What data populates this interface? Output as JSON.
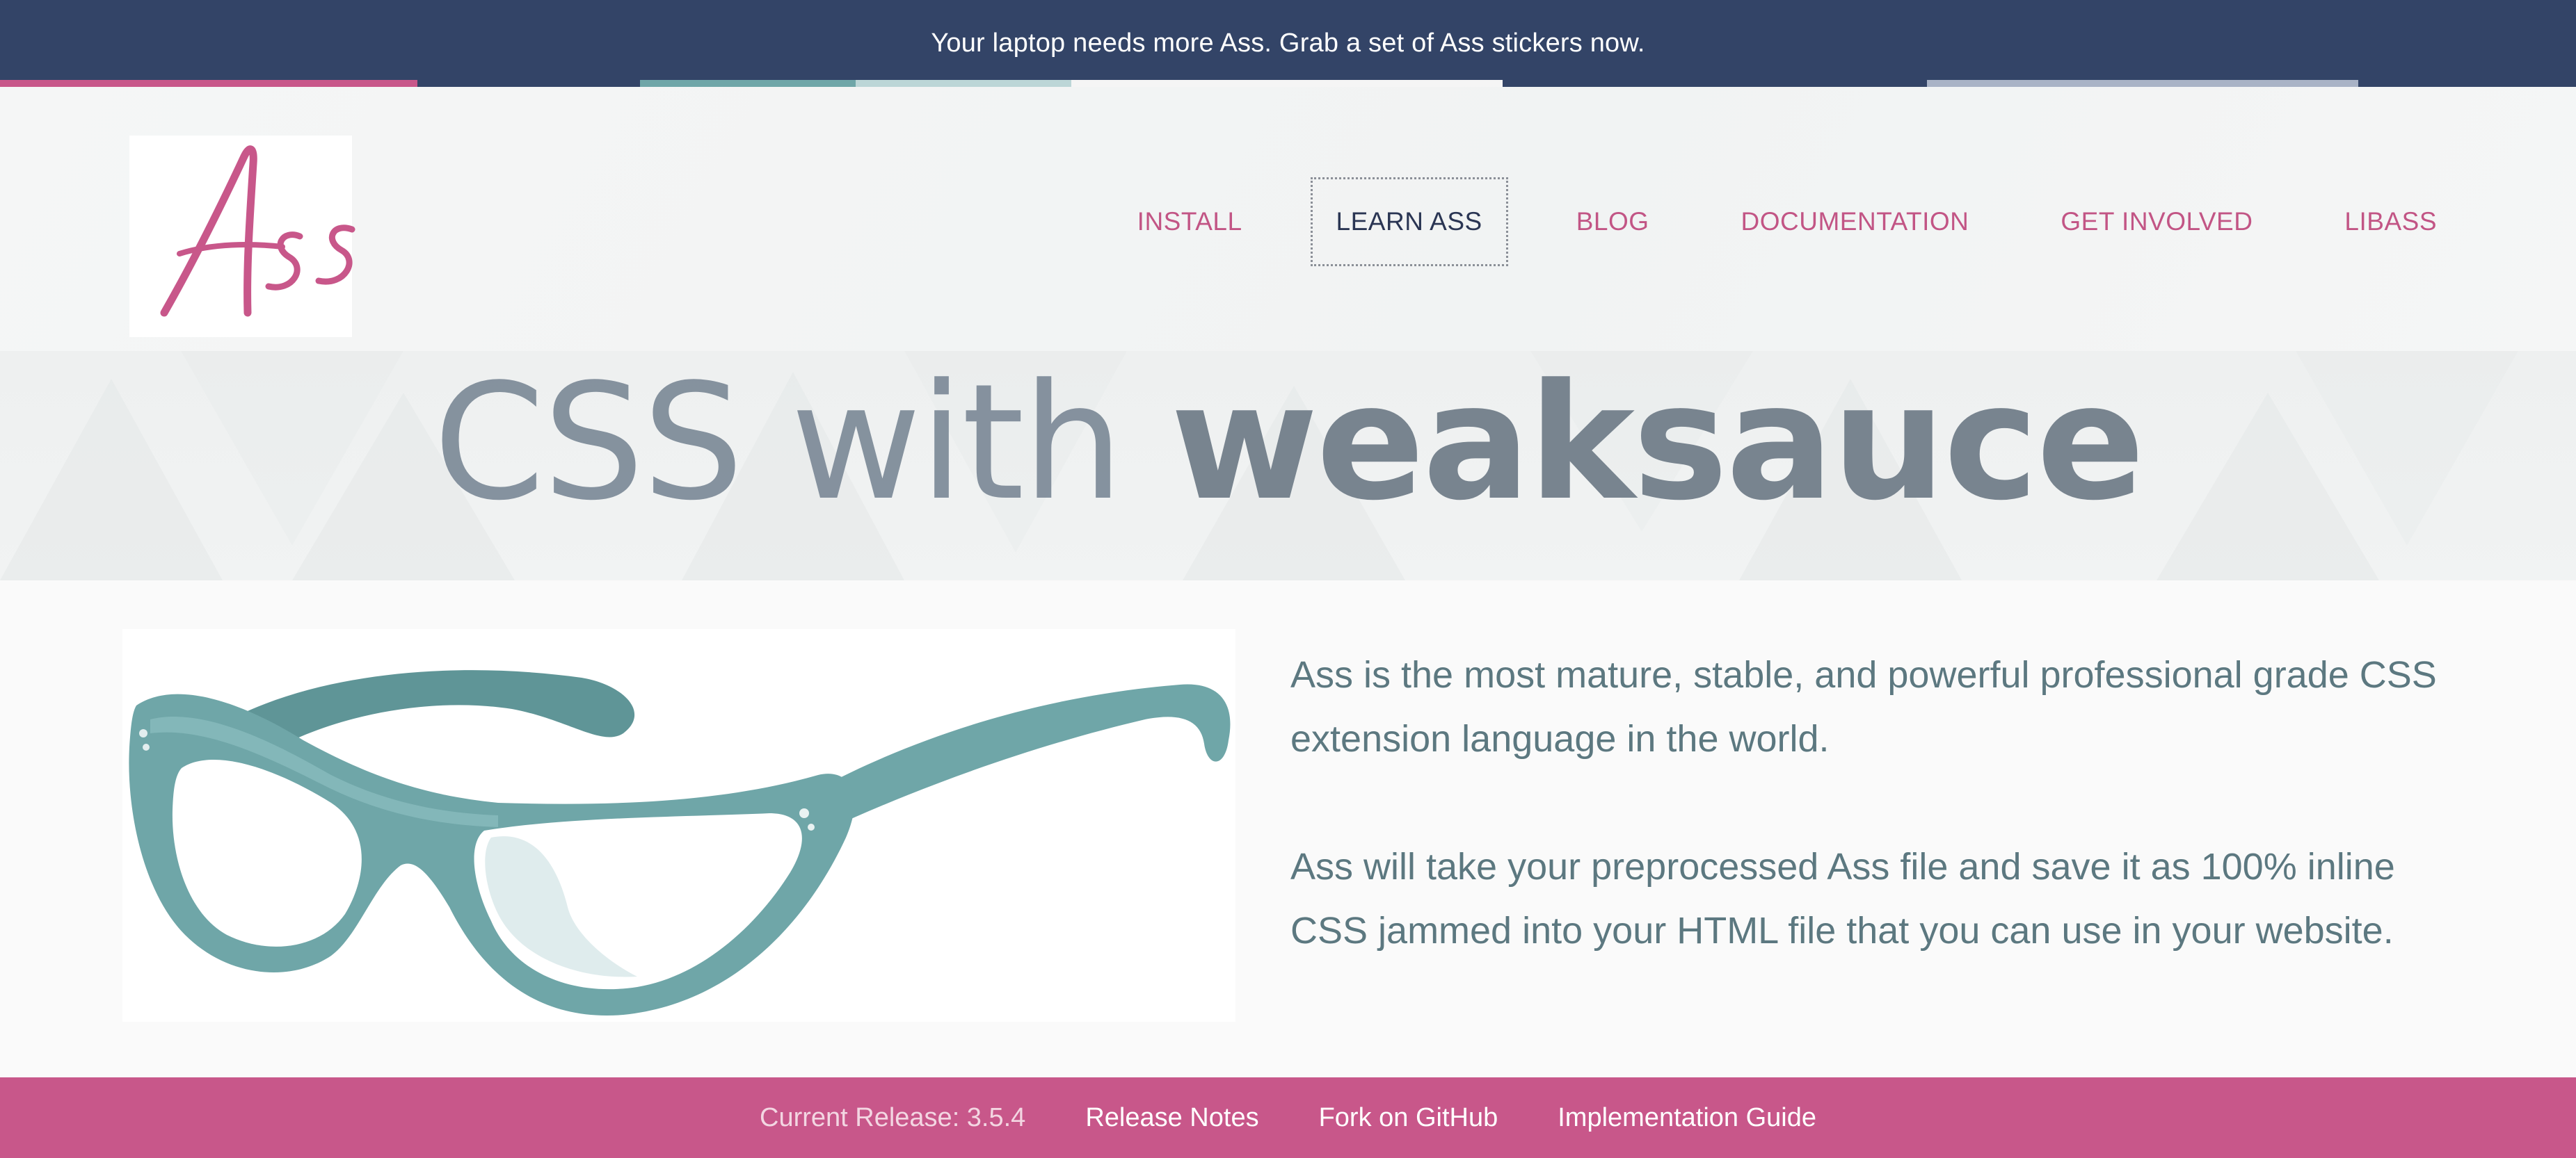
{
  "banner": {
    "text": "Your laptop needs more Ass. Grab a set of Ass stickers now."
  },
  "logo": {
    "text": "Ass"
  },
  "nav": {
    "items": [
      {
        "label": "INSTALL"
      },
      {
        "label": "LEARN ASS",
        "active": true
      },
      {
        "label": "BLOG"
      },
      {
        "label": "DOCUMENTATION"
      },
      {
        "label": "GET INVOLVED"
      },
      {
        "label": "LIBASS"
      }
    ]
  },
  "hero": {
    "title_light": "CSS with ",
    "title_bold": "weaksauce"
  },
  "intro": {
    "p1": "Ass is the most mature, stable, and powerful professional grade CSS extension language in the world.",
    "p2": "Ass will take your preprocessed Ass file and save it as 100% inline CSS jammed into your HTML file that you can use in your website."
  },
  "footer": {
    "release": "Current Release: 3.5.4",
    "release_notes": "Release Notes",
    "fork": "Fork on GitHub",
    "guide": "Implementation Guide"
  },
  "colors": {
    "banner": "#334467",
    "accent_pink": "#c8578a",
    "nav_pink": "#c25585",
    "glasses_teal": "#6fa6a8",
    "text_teal": "#5c7880"
  }
}
